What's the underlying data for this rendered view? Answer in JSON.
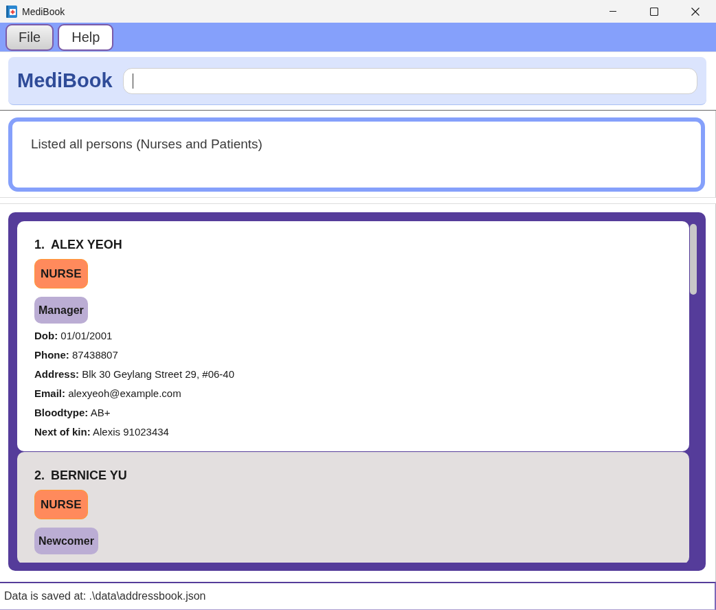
{
  "window": {
    "title": "MediBook",
    "controls": [
      {
        "kind": "minimize"
      },
      {
        "kind": "maximize"
      },
      {
        "kind": "close"
      }
    ]
  },
  "menu": [
    {
      "label": "File",
      "selected": true
    },
    {
      "label": "Help",
      "selected": false
    }
  ],
  "header": {
    "app_name": "MediBook",
    "command_box": {
      "focused": true
    }
  },
  "result_display": {
    "message": "Listed all persons (Nurses and Patients)"
  },
  "persons": [
    {
      "index": "1.",
      "name": "ALEX YEOH",
      "role": "NURSE",
      "tags": [
        "Manager"
      ],
      "details": [
        "**Dob:** 01/01/2001",
        "**Phone:** 87438807",
        "**Address:** Blk 30 Geylang Street 29, #06-40",
        "**Email:** alexyeoh@example.com",
        "**Bloodtype:** AB+",
        "**Next of kin:** Alexis 91023434"
      ],
      "selected": false
    },
    {
      "index": "2.",
      "name": "BERNICE YU",
      "role": "NURSE",
      "tags": [
        "Newcomer"
      ],
      "selected": true
    }
  ],
  "status_bar": {
    "text": "Data is saved at: .\\data\\addressbook.json"
  }
}
